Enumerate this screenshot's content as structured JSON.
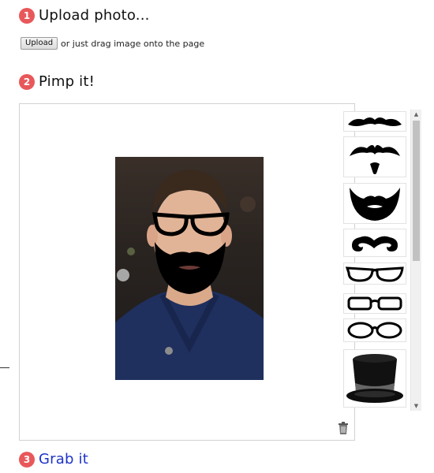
{
  "steps": [
    {
      "number": "1",
      "title": "Upload photo..."
    },
    {
      "number": "2",
      "title": "Pimp it!"
    },
    {
      "number": "3",
      "title": "Grab it"
    }
  ],
  "upload": {
    "button_label": "Upload",
    "hint": "or just drag image onto the page"
  },
  "palette": {
    "items": [
      "mustache-icon",
      "mustache-goatee-icon",
      "beard-icon",
      "curly-mustache-icon",
      "glasses-cateye-icon",
      "glasses-rect-icon",
      "glasses-oval-icon",
      "top-hat-icon"
    ]
  },
  "colors": {
    "badge": "#e8585a",
    "link": "#1d33c8"
  }
}
